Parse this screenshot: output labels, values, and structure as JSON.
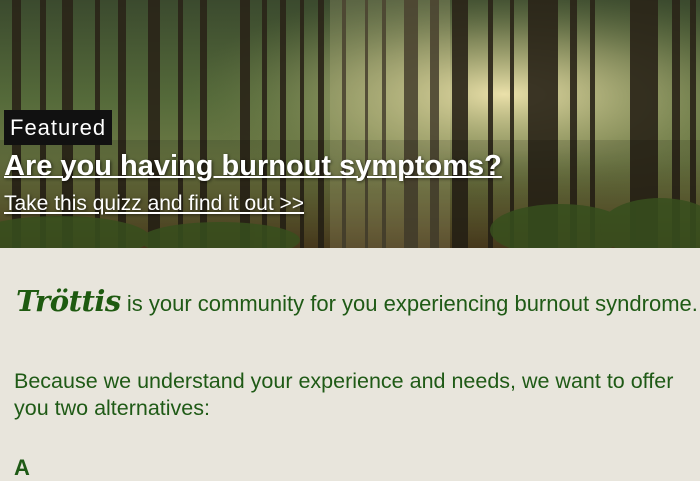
{
  "hero": {
    "badge": "Featured",
    "title": "Are you having burnout symptoms?",
    "subtitle": "Take this quizz and find it out >>"
  },
  "intro": {
    "brand": "Tröttis",
    "text": " is your community for you experiencing burnout syndrome."
  },
  "body": {
    "paragraph": "Because we understand your experience and needs, we want to offer you two alternatives:",
    "cut_bold": "A",
    "cut_rest": ""
  },
  "colors": {
    "text_green": "#1f5a16",
    "background": "#e8e5dc",
    "badge_bg": "#111111"
  }
}
